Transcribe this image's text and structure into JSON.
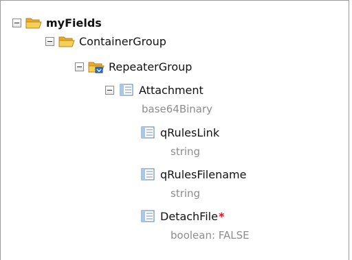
{
  "tree": {
    "root": {
      "label": "myFields",
      "icon": "folder-open-icon"
    },
    "container": {
      "label": "ContainerGroup",
      "icon": "folder-open-icon"
    },
    "repeater": {
      "label": "RepeaterGroup",
      "icon": "repeating-folder-icon"
    },
    "attachment": {
      "label": "Attachment",
      "type": "base64Binary",
      "icon": "field-icon"
    },
    "qrules_link": {
      "label": "qRulesLink",
      "type": "string",
      "icon": "field-icon"
    },
    "qrules_filename": {
      "label": "qRulesFilename",
      "type": "string",
      "icon": "field-icon"
    },
    "detach_file": {
      "label": "DetachFile",
      "required_mark": "*",
      "type": "boolean: FALSE",
      "icon": "field-icon"
    }
  },
  "colors": {
    "folder": "#f3c33c",
    "field": "#8fb7dd",
    "required": "#e0141e",
    "type_text": "#8c8c8c"
  }
}
